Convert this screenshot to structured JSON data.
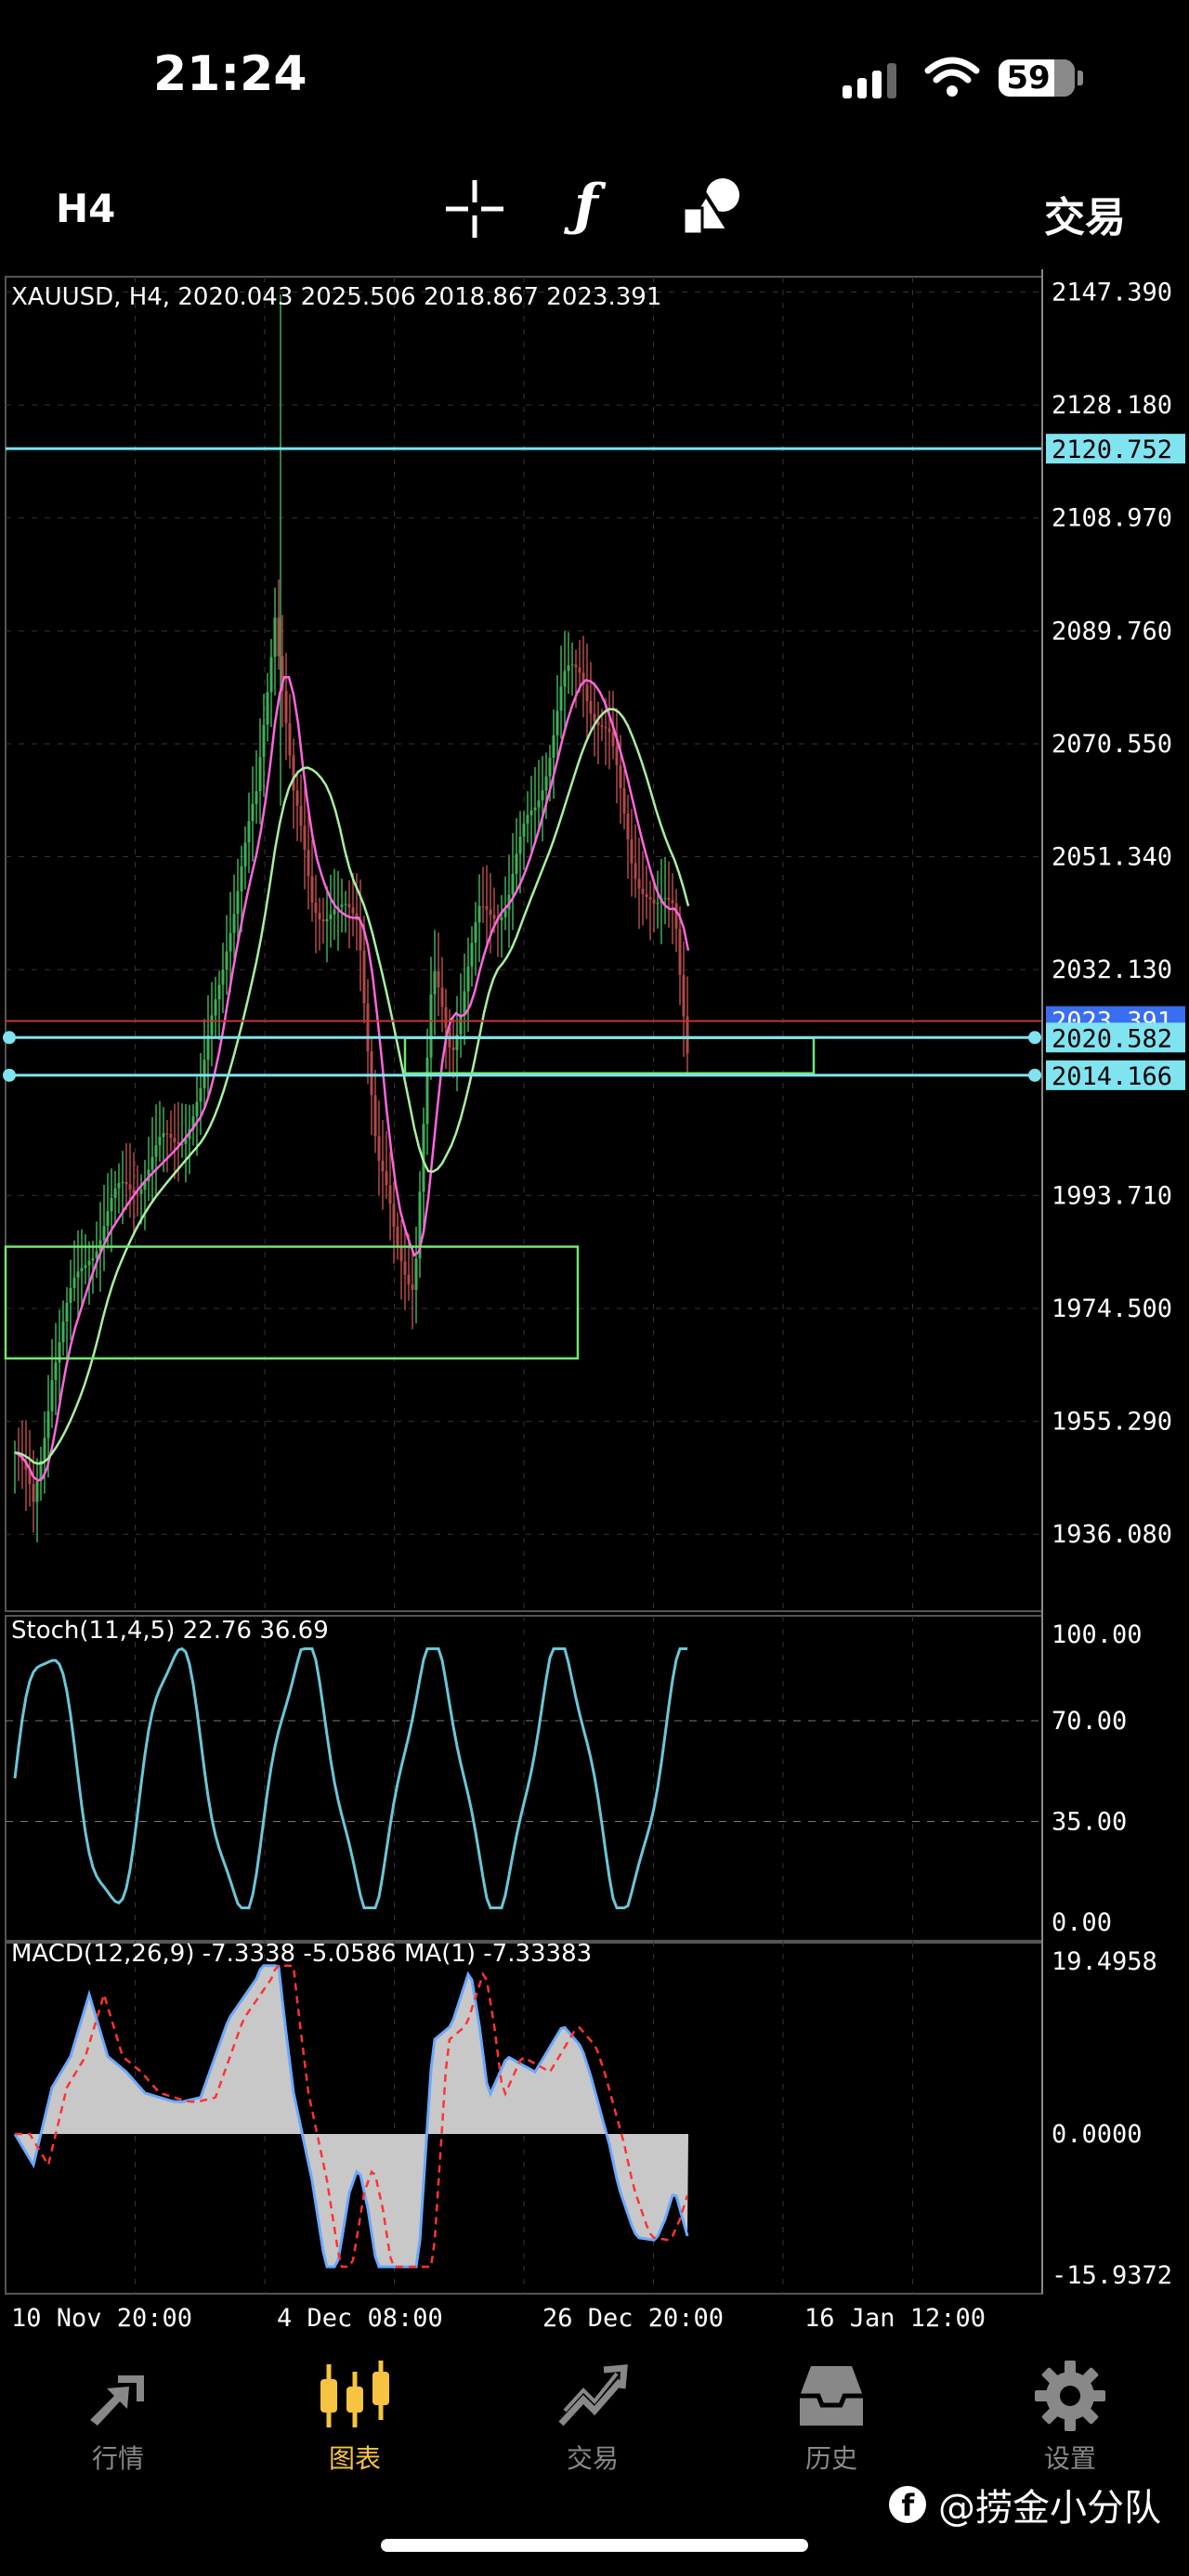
{
  "status_bar": {
    "time": "21:24",
    "battery": "59"
  },
  "toolbar": {
    "timeframe": "H4",
    "trade_label": "交易",
    "icons": [
      "crosshair-icon",
      "function-icon",
      "objects-icon"
    ]
  },
  "chart": {
    "header": "XAUUSD, H4, 2020.043 2025.506 2018.867 2023.391",
    "price_ticks": [
      "2147.390",
      "2128.180",
      "2108.970",
      "2089.760",
      "2070.550",
      "2051.340",
      "2032.130",
      "1993.710",
      "1974.500",
      "1955.290",
      "1936.080"
    ],
    "price_tick_values": [
      2147.39,
      2128.18,
      2108.97,
      2089.76,
      2070.55,
      2051.34,
      2032.13,
      1993.71,
      1974.5,
      1955.29,
      1936.08
    ],
    "price_range": [
      1923,
      2150
    ],
    "current_price": "2023.391",
    "current_price_value": 2023.391,
    "levels": [
      {
        "label": "2120.752",
        "value": 2120.752
      },
      {
        "label": "2020.582",
        "value": 2020.582
      },
      {
        "label": "2014.166",
        "value": 2014.166
      }
    ],
    "stoch": {
      "header": "Stoch(11,4,5) 22.76 36.69",
      "ticks": [
        "100.00",
        "70.00",
        "35.00",
        "0.00"
      ],
      "tick_values": [
        100,
        70,
        35,
        0
      ]
    },
    "macd": {
      "header": "MACD(12,26,9) -7.3338 -5.0586 MA(1) -7.33383",
      "ticks": [
        "19.4958",
        "0.0000",
        "-15.9372"
      ],
      "tick_values": [
        19.4958,
        0,
        -15.9372
      ]
    },
    "time_labels": [
      "10 Nov 20:00",
      "4 Dec 08:00",
      "26 Dec 20:00",
      "16 Jan 12:00"
    ],
    "colors": {
      "level": "#7fe3f0",
      "zone": "#6fe86f",
      "ma_fast": "#ff66dd",
      "ma_slow": "#a8f0a0",
      "stoch": "#6cc6d8",
      "macd_fill": "#c8c8c8",
      "macd_line": "#6aa8ff",
      "signal": "#ff3333",
      "current": "#c0392b"
    }
  },
  "tabbar": {
    "items": [
      {
        "label": "行情",
        "icon": "quotes-icon",
        "active": false
      },
      {
        "label": "图表",
        "icon": "chart-icon",
        "active": true
      },
      {
        "label": "交易",
        "icon": "trade-icon",
        "active": false
      },
      {
        "label": "历史",
        "icon": "history-icon",
        "active": false
      },
      {
        "label": "设置",
        "icon": "settings-icon",
        "active": false
      }
    ]
  },
  "watermark": "@捞金小分队"
}
